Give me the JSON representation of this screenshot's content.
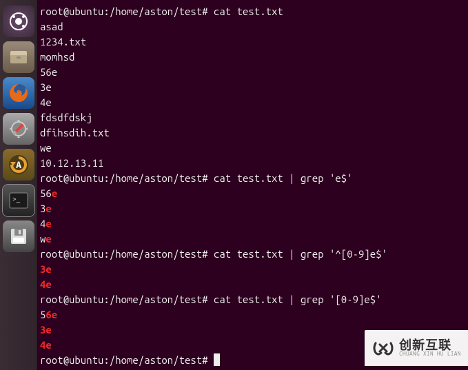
{
  "launcher": {
    "items": [
      {
        "name": "dash-icon",
        "bg": "#3a2e3a"
      },
      {
        "name": "files-icon",
        "bg": "#5a4a40"
      },
      {
        "name": "firefox-icon",
        "bg": "#1a3a5a"
      },
      {
        "name": "settings-icon",
        "bg": "#6a6a6a"
      },
      {
        "name": "updater-icon",
        "bg": "#4a3a1a"
      },
      {
        "name": "terminal-icon",
        "bg": "#2a2a2a",
        "active": true
      },
      {
        "name": "disk-icon",
        "bg": "#4a4a4a"
      }
    ]
  },
  "terminal": {
    "prompt": "root@ubuntu:/home/aston/test#",
    "blocks": [
      {
        "cmd": "cat test.txt",
        "output": [
          {
            "plain": "asad"
          },
          {
            "plain": "1234.txt"
          },
          {
            "plain": "momhsd"
          },
          {
            "plain": "56e"
          },
          {
            "plain": "3e"
          },
          {
            "plain": "4e"
          },
          {
            "plain": "fdsdfdskj"
          },
          {
            "plain": "dfihsdih.txt"
          },
          {
            "plain": "we"
          },
          {
            "plain": "10.12.13.11"
          }
        ]
      },
      {
        "cmd": "cat test.txt | grep 'e$'",
        "output": [
          {
            "pre": "56",
            "hl": "e"
          },
          {
            "pre": "3",
            "hl": "e"
          },
          {
            "pre": "4",
            "hl": "e"
          },
          {
            "pre": "w",
            "hl": "e"
          }
        ]
      },
      {
        "cmd": "cat test.txt | grep '^[0-9]e$'",
        "output": [
          {
            "hl": "3e"
          },
          {
            "hl": "4e"
          }
        ]
      },
      {
        "cmd": "cat test.txt | grep '[0-9]e$'",
        "output": [
          {
            "pre": "5",
            "hl": "6e"
          },
          {
            "hl": "3e"
          },
          {
            "hl": "4e"
          }
        ]
      }
    ]
  },
  "watermark": {
    "cn": "创新互联",
    "en": "CHUANG XIN HU LIAN"
  }
}
